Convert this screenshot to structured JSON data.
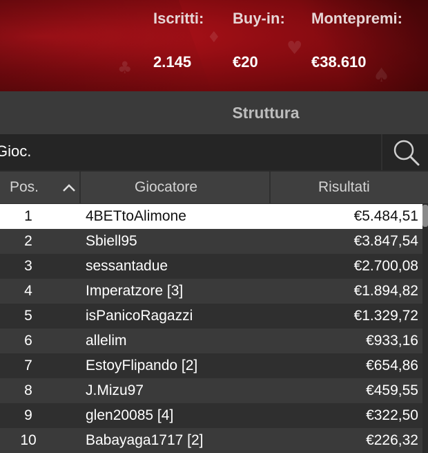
{
  "summary": {
    "entrants_label": "Iscritti:",
    "entrants_value": "2.145",
    "buyin_label": "Buy-in:",
    "buyin_value": "€20",
    "prizepool_label": "Montepremi:",
    "prizepool_value": "€38.610"
  },
  "tab": {
    "title": "Struttura"
  },
  "search": {
    "value": "Gioc."
  },
  "table": {
    "columns": {
      "pos": "Pos.",
      "player": "Giocatore",
      "result": "Risultati"
    },
    "rows": [
      {
        "pos": "1",
        "player": "4BETtoAlimone",
        "result": "€5.484,51"
      },
      {
        "pos": "2",
        "player": "Sbiell95",
        "result": "€3.847,54"
      },
      {
        "pos": "3",
        "player": "sessantadue",
        "result": "€2.700,08"
      },
      {
        "pos": "4",
        "player": "Imperatzore [3]",
        "result": "€1.894,82"
      },
      {
        "pos": "5",
        "player": "isPanicoRagazzi",
        "result": "€1.329,72"
      },
      {
        "pos": "6",
        "player": "allelim",
        "result": "€933,16"
      },
      {
        "pos": "7",
        "player": "EstoyFlipando [2]",
        "result": "€654,86"
      },
      {
        "pos": "8",
        "player": "J.Mizu97",
        "result": "€459,55"
      },
      {
        "pos": "9",
        "player": "glen20085 [4]",
        "result": "€322,50"
      },
      {
        "pos": "10",
        "player": "Babayaga1717 [2]",
        "result": "€226,32"
      }
    ]
  },
  "icons": {
    "search": "search-icon",
    "sort": "chevron-up-icon"
  },
  "colors": {
    "banner": "#b0121a",
    "selected_row": "#ffffff",
    "row_dark": "#2f2f2f",
    "row_light": "#3a3a3a"
  }
}
